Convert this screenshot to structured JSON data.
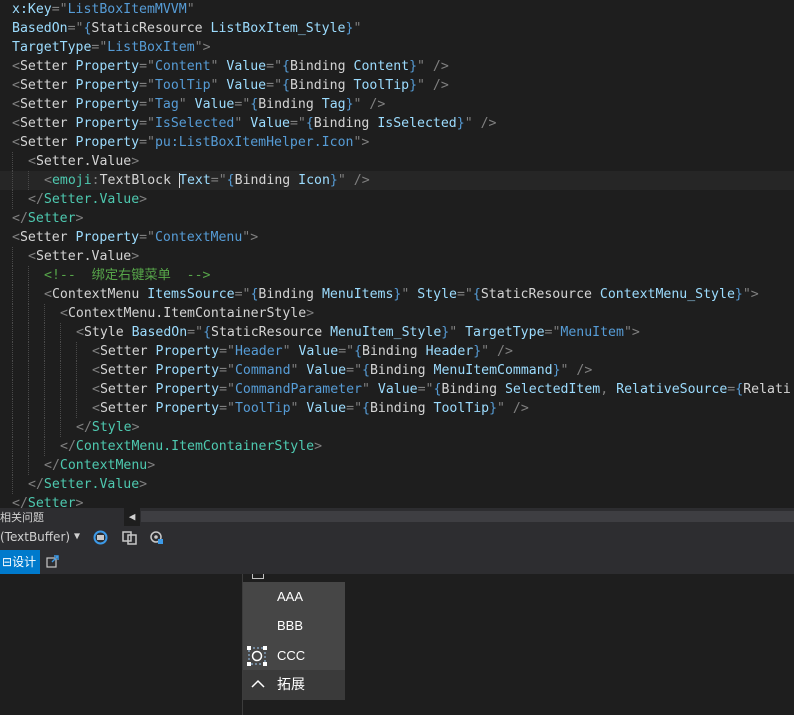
{
  "editor": {
    "lines": [
      {
        "segs": [
          [
            "a",
            "x:Key"
          ],
          [
            "p",
            "=\""
          ],
          [
            "v",
            "ListBoxItemMVVM"
          ],
          [
            "p",
            "\""
          ]
        ]
      },
      {
        "segs": [
          [
            "a",
            "BasedOn"
          ],
          [
            "p",
            "=\""
          ],
          [
            "v",
            "{"
          ],
          [
            "e",
            "StaticResource "
          ],
          [
            "a",
            "ListBoxItem_Style"
          ],
          [
            "v",
            "}"
          ],
          [
            "p",
            "\""
          ]
        ]
      },
      {
        "segs": [
          [
            "a",
            "TargetType"
          ],
          [
            "p",
            "=\""
          ],
          [
            "v",
            "ListBoxItem"
          ],
          [
            "p",
            "\">"
          ]
        ]
      },
      {
        "segs": [
          [
            "p",
            "<"
          ],
          [
            "e",
            "Setter "
          ],
          [
            "a",
            "Property"
          ],
          [
            "p",
            "=\""
          ],
          [
            "v",
            "Content"
          ],
          [
            "p",
            "\" "
          ],
          [
            "a",
            "Value"
          ],
          [
            "p",
            "=\""
          ],
          [
            "v",
            "{"
          ],
          [
            "e",
            "Binding "
          ],
          [
            "a",
            "Content"
          ],
          [
            "v",
            "}"
          ],
          [
            "p",
            "\" />"
          ]
        ]
      },
      {
        "segs": [
          [
            "p",
            "<"
          ],
          [
            "e",
            "Setter "
          ],
          [
            "a",
            "Property"
          ],
          [
            "p",
            "=\""
          ],
          [
            "v",
            "ToolTip"
          ],
          [
            "p",
            "\" "
          ],
          [
            "a",
            "Value"
          ],
          [
            "p",
            "=\""
          ],
          [
            "v",
            "{"
          ],
          [
            "e",
            "Binding "
          ],
          [
            "a",
            "ToolTip"
          ],
          [
            "v",
            "}"
          ],
          [
            "p",
            "\" />"
          ]
        ]
      },
      {
        "segs": [
          [
            "p",
            "<"
          ],
          [
            "e",
            "Setter "
          ],
          [
            "a",
            "Property"
          ],
          [
            "p",
            "=\""
          ],
          [
            "v",
            "Tag"
          ],
          [
            "p",
            "\" "
          ],
          [
            "a",
            "Value"
          ],
          [
            "p",
            "=\""
          ],
          [
            "v",
            "{"
          ],
          [
            "e",
            "Binding "
          ],
          [
            "a",
            "Tag"
          ],
          [
            "v",
            "}"
          ],
          [
            "p",
            "\" />"
          ]
        ]
      },
      {
        "segs": [
          [
            "p",
            "<"
          ],
          [
            "e",
            "Setter "
          ],
          [
            "a",
            "Property"
          ],
          [
            "p",
            "=\""
          ],
          [
            "v",
            "IsSelected"
          ],
          [
            "p",
            "\" "
          ],
          [
            "a",
            "Value"
          ],
          [
            "p",
            "=\""
          ],
          [
            "v",
            "{"
          ],
          [
            "e",
            "Binding "
          ],
          [
            "a",
            "IsSelected"
          ],
          [
            "v",
            "}"
          ],
          [
            "p",
            "\" />"
          ]
        ]
      },
      {
        "segs": [
          [
            "p",
            "<"
          ],
          [
            "e",
            "Setter "
          ],
          [
            "a",
            "Property"
          ],
          [
            "p",
            "=\""
          ],
          [
            "v",
            "pu:ListBoxItemHelper.Icon"
          ],
          [
            "p",
            "\">"
          ]
        ]
      },
      {
        "segs": [
          [
            "p",
            "<"
          ],
          [
            "e",
            "Setter.Value"
          ],
          [
            "p",
            ">"
          ]
        ]
      },
      {
        "segs": [
          [
            "p",
            "<"
          ],
          [
            "tk",
            "emoji"
          ],
          [
            "p",
            ":"
          ],
          [
            "e",
            "TextBlock "
          ],
          [
            "caret",
            ""
          ],
          [
            "a",
            "Text"
          ],
          [
            "p",
            "=\""
          ],
          [
            "v",
            "{"
          ],
          [
            "e",
            "Binding "
          ],
          [
            "a",
            "Icon"
          ],
          [
            "v",
            "}"
          ],
          [
            "p",
            "\" />"
          ]
        ]
      },
      {
        "segs": [
          [
            "p",
            "</"
          ],
          [
            "t",
            "Setter.Value"
          ],
          [
            "p",
            ">"
          ]
        ]
      },
      {
        "segs": [
          [
            "p",
            "</"
          ],
          [
            "t",
            "Setter"
          ],
          [
            "p",
            ">"
          ]
        ]
      },
      {
        "segs": [
          [
            "p",
            "<"
          ],
          [
            "e",
            "Setter "
          ],
          [
            "a",
            "Property"
          ],
          [
            "p",
            "=\""
          ],
          [
            "v",
            "ContextMenu"
          ],
          [
            "p",
            "\">"
          ]
        ]
      },
      {
        "segs": [
          [
            "p",
            "<"
          ],
          [
            "e",
            "Setter.Value"
          ],
          [
            "p",
            ">"
          ]
        ]
      },
      {
        "segs": [
          [
            "c",
            "<!--  绑定右键菜单  -->"
          ]
        ]
      },
      {
        "segs": [
          [
            "p",
            "<"
          ],
          [
            "e",
            "ContextMenu "
          ],
          [
            "a",
            "ItemsSource"
          ],
          [
            "p",
            "=\""
          ],
          [
            "v",
            "{"
          ],
          [
            "e",
            "Binding "
          ],
          [
            "a",
            "MenuItems"
          ],
          [
            "v",
            "}"
          ],
          [
            "p",
            "\" "
          ],
          [
            "a",
            "Style"
          ],
          [
            "p",
            "=\""
          ],
          [
            "v",
            "{"
          ],
          [
            "e",
            "StaticResource "
          ],
          [
            "a",
            "ContextMenu_Style"
          ],
          [
            "v",
            "}"
          ],
          [
            "p",
            "\">"
          ]
        ]
      },
      {
        "segs": [
          [
            "p",
            "<"
          ],
          [
            "e",
            "ContextMenu.ItemContainerStyle"
          ],
          [
            "p",
            ">"
          ]
        ]
      },
      {
        "segs": [
          [
            "p",
            "<"
          ],
          [
            "e",
            "Style "
          ],
          [
            "a",
            "BasedOn"
          ],
          [
            "p",
            "=\""
          ],
          [
            "v",
            "{"
          ],
          [
            "e",
            "StaticResource "
          ],
          [
            "a",
            "MenuItem_Style"
          ],
          [
            "v",
            "}"
          ],
          [
            "p",
            "\" "
          ],
          [
            "a",
            "TargetType"
          ],
          [
            "p",
            "=\""
          ],
          [
            "v",
            "MenuItem"
          ],
          [
            "p",
            "\">"
          ]
        ]
      },
      {
        "segs": [
          [
            "p",
            "<"
          ],
          [
            "e",
            "Setter "
          ],
          [
            "a",
            "Property"
          ],
          [
            "p",
            "=\""
          ],
          [
            "v",
            "Header"
          ],
          [
            "p",
            "\" "
          ],
          [
            "a",
            "Value"
          ],
          [
            "p",
            "=\""
          ],
          [
            "v",
            "{"
          ],
          [
            "e",
            "Binding "
          ],
          [
            "a",
            "Header"
          ],
          [
            "v",
            "}"
          ],
          [
            "p",
            "\" />"
          ]
        ]
      },
      {
        "segs": [
          [
            "p",
            "<"
          ],
          [
            "e",
            "Setter "
          ],
          [
            "a",
            "Property"
          ],
          [
            "p",
            "=\""
          ],
          [
            "v",
            "Command"
          ],
          [
            "p",
            "\" "
          ],
          [
            "a",
            "Value"
          ],
          [
            "p",
            "=\""
          ],
          [
            "v",
            "{"
          ],
          [
            "e",
            "Binding "
          ],
          [
            "a",
            "MenuItemCommand"
          ],
          [
            "v",
            "}"
          ],
          [
            "p",
            "\" />"
          ]
        ]
      },
      {
        "segs": [
          [
            "p",
            "<"
          ],
          [
            "e",
            "Setter "
          ],
          [
            "a",
            "Property"
          ],
          [
            "p",
            "=\""
          ],
          [
            "v",
            "CommandParameter"
          ],
          [
            "p",
            "\" "
          ],
          [
            "a",
            "Value"
          ],
          [
            "p",
            "=\""
          ],
          [
            "v",
            "{"
          ],
          [
            "e",
            "Binding "
          ],
          [
            "a",
            "SelectedItem"
          ],
          [
            "p",
            ", "
          ],
          [
            "a",
            "RelativeSource"
          ],
          [
            "p",
            "="
          ],
          [
            "v",
            "{"
          ],
          [
            "e",
            "Relati"
          ]
        ]
      },
      {
        "segs": [
          [
            "p",
            "<"
          ],
          [
            "e",
            "Setter "
          ],
          [
            "a",
            "Property"
          ],
          [
            "p",
            "=\""
          ],
          [
            "v",
            "ToolTip"
          ],
          [
            "p",
            "\" "
          ],
          [
            "a",
            "Value"
          ],
          [
            "p",
            "=\""
          ],
          [
            "v",
            "{"
          ],
          [
            "e",
            "Binding "
          ],
          [
            "a",
            "ToolTip"
          ],
          [
            "v",
            "}"
          ],
          [
            "p",
            "\" />"
          ]
        ]
      },
      {
        "segs": [
          [
            "p",
            "</"
          ],
          [
            "t",
            "Style"
          ],
          [
            "p",
            ">"
          ]
        ]
      },
      {
        "segs": [
          [
            "p",
            "</"
          ],
          [
            "t",
            "ContextMenu.ItemContainerStyle"
          ],
          [
            "p",
            ">"
          ]
        ]
      },
      {
        "segs": [
          [
            "p",
            "</"
          ],
          [
            "t",
            "ContextMenu"
          ],
          [
            "p",
            ">"
          ]
        ]
      },
      {
        "segs": [
          [
            "p",
            "</"
          ],
          [
            "t",
            "Setter.Value"
          ],
          [
            "p",
            ">"
          ]
        ]
      },
      {
        "segs": [
          [
            "p",
            "</"
          ],
          [
            "t",
            "Setter"
          ],
          [
            "p",
            ">"
          ]
        ]
      }
    ]
  },
  "panel": {
    "related_label": "相关问题",
    "scope_label": "(TextBuffer)",
    "design_tab": "设计"
  },
  "context_menu": {
    "items": [
      "AAA",
      "BBB",
      "CCC"
    ],
    "expand_label": "拓展"
  },
  "colors": {
    "background": "#1e1e1e",
    "accent": "#007acc",
    "menu_bg": "#464646"
  }
}
